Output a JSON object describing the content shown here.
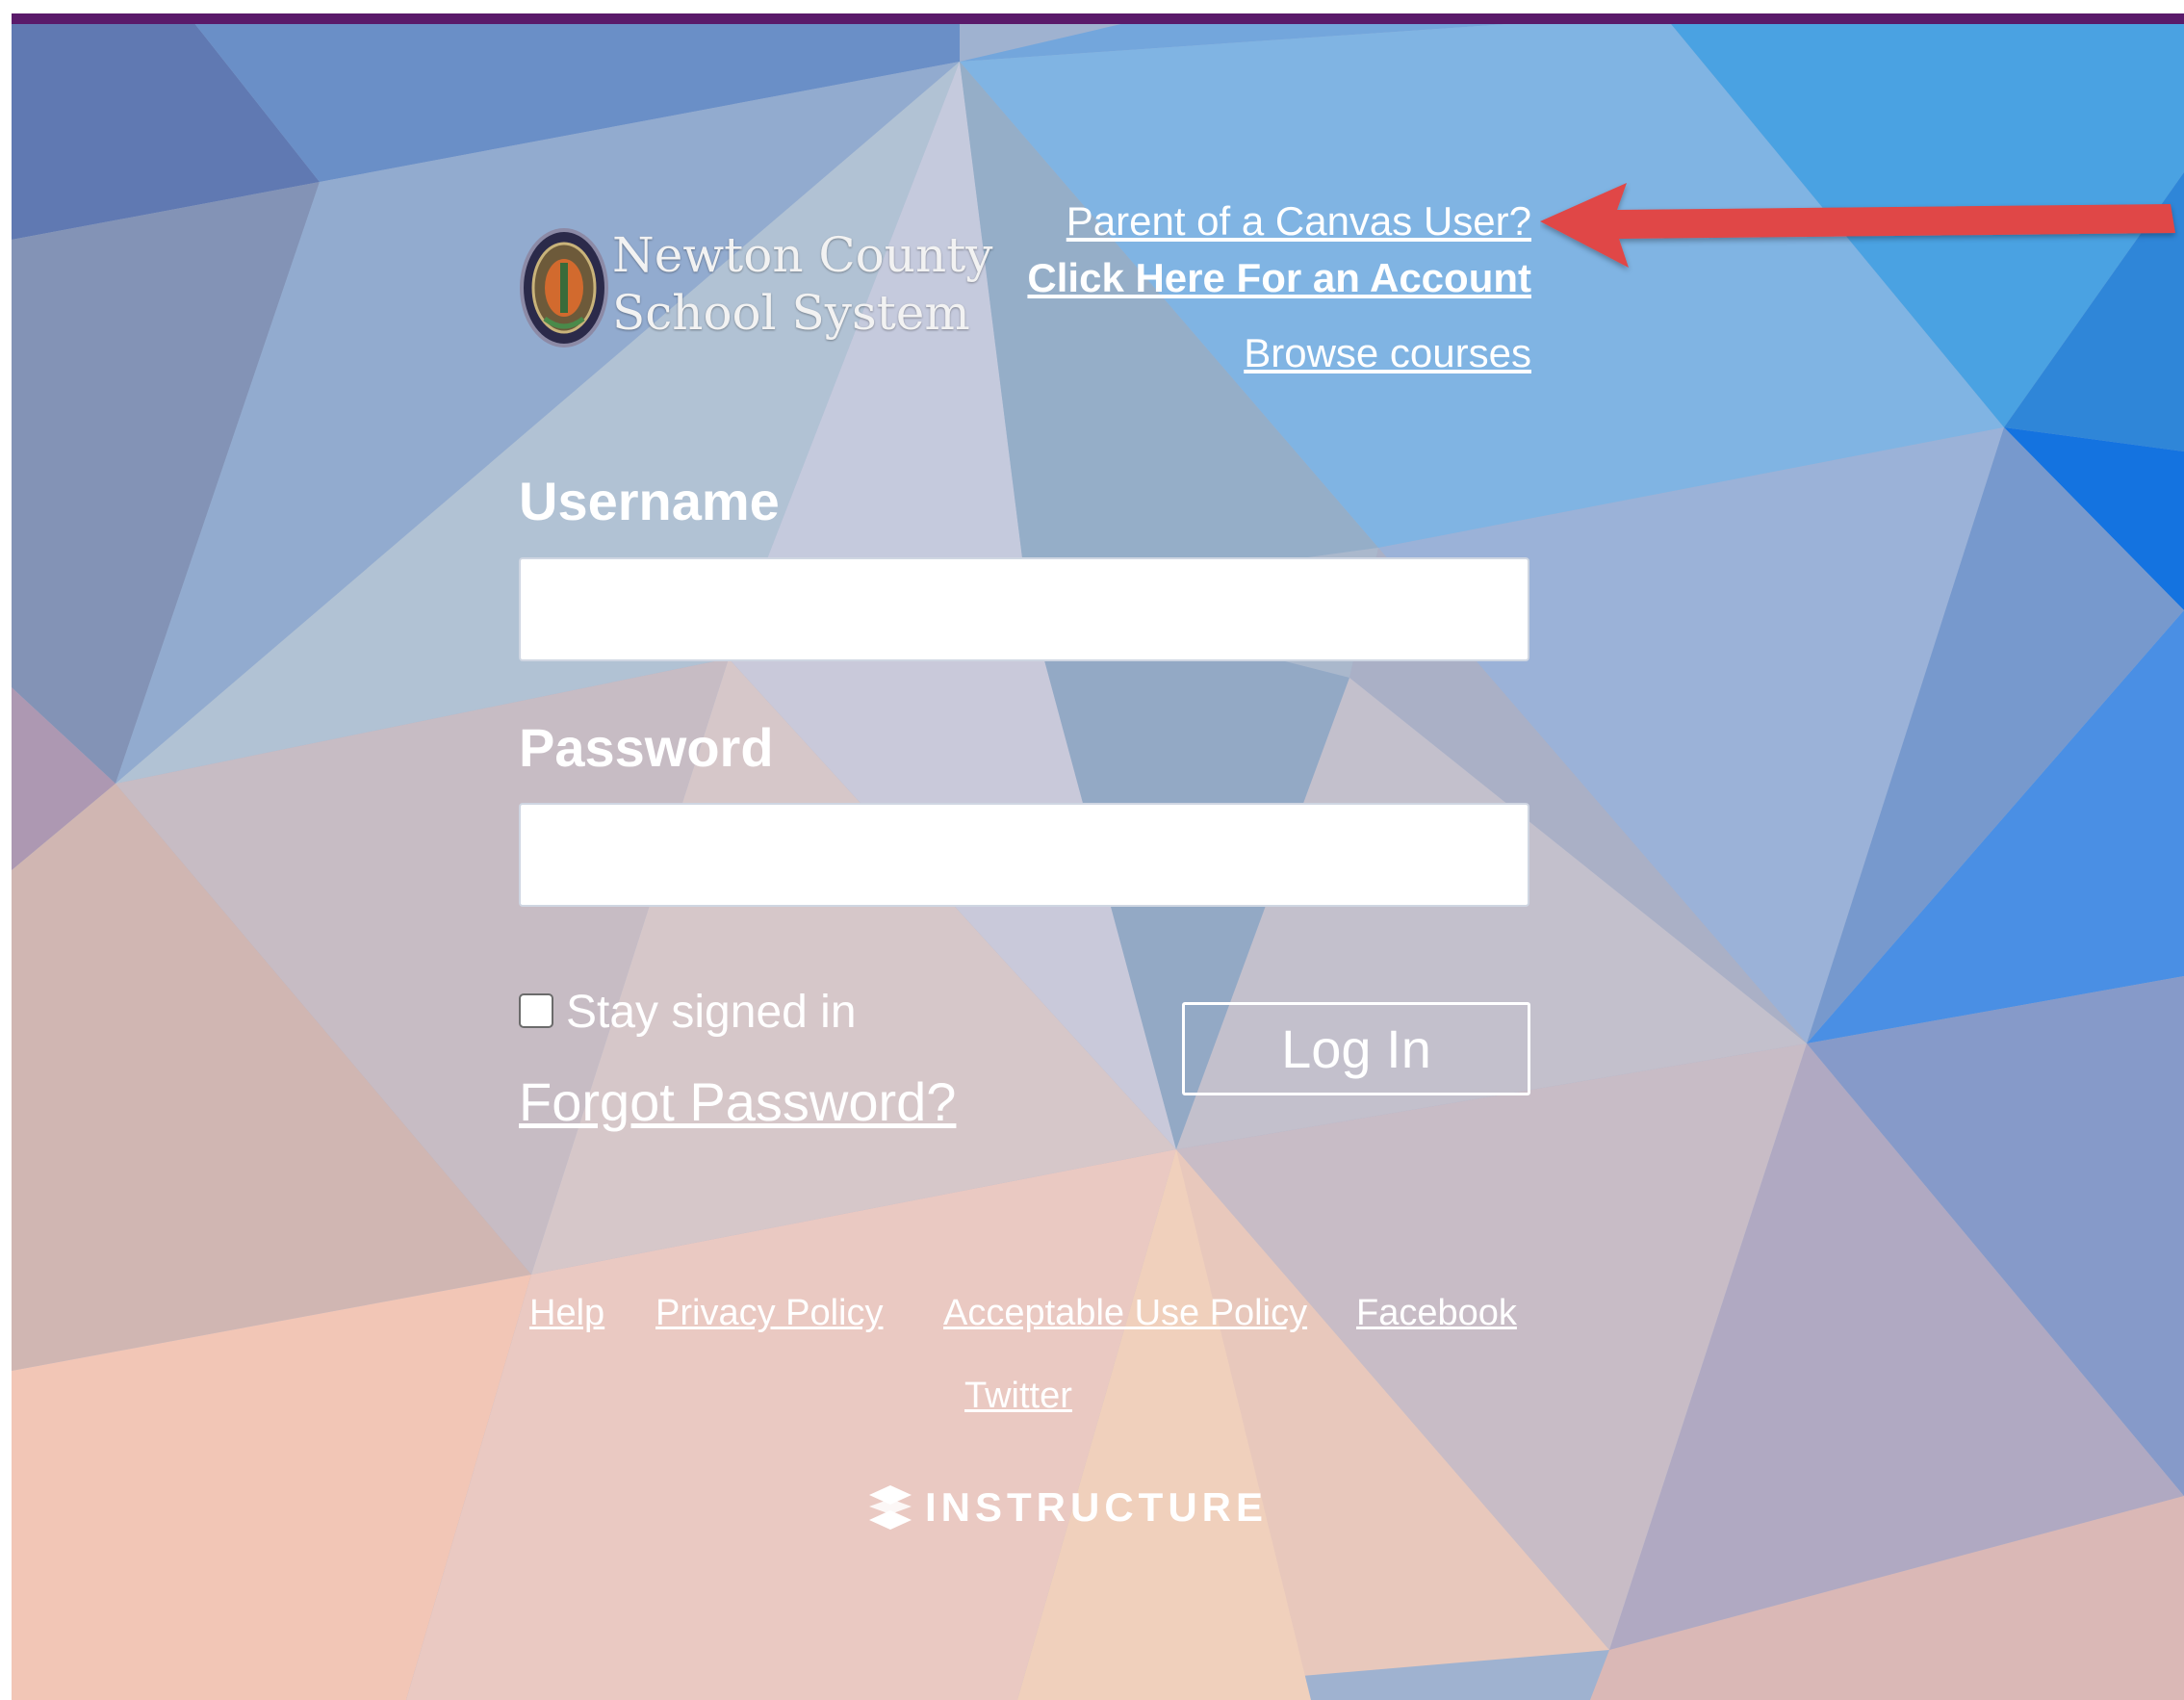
{
  "branding": {
    "school_name_line1": "Newton County",
    "school_name_line2": "School System",
    "vendor": "INSTRUCTURE"
  },
  "header_links": {
    "parent_question": "Parent of a Canvas User?",
    "create_account": "Click Here For an Account",
    "browse_courses": "Browse courses"
  },
  "login": {
    "username_label": "Username",
    "username_value": "",
    "password_label": "Password",
    "password_value": "",
    "stay_signed_in": "Stay signed in",
    "stay_signed_in_checked": false,
    "forgot_password": "Forgot Password?",
    "submit": "Log In"
  },
  "footer": {
    "links": [
      "Help",
      "Privacy Policy",
      "Acceptable Use Policy",
      "Facebook",
      "Twitter"
    ]
  },
  "colors": {
    "top_bar": "#5a1a6a",
    "arrow": "#e04646",
    "text": "#ffffff"
  },
  "icons": {
    "logo": "school-seal-icon",
    "vendor": "instructure-logo-icon",
    "annotation": "red-arrow-icon"
  }
}
